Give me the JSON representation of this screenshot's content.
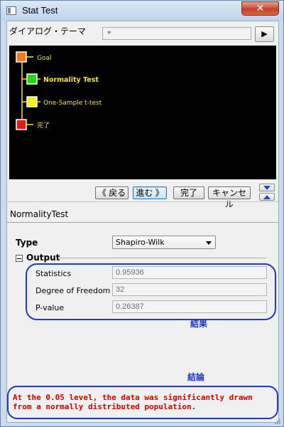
{
  "window": {
    "title": "Stat Test",
    "close_glyph": "✕"
  },
  "theme": {
    "label": "ダイアログ・テーマ",
    "value": "*",
    "play_glyph": "▶"
  },
  "tree": {
    "nodes": [
      {
        "label": "Goal",
        "color": "#f07b1c",
        "bold": false
      },
      {
        "label": "Normality Test",
        "color": "#22d90f",
        "bold": true
      },
      {
        "label": "One-Sample t-test",
        "color": "#f3ef1a",
        "bold": false
      },
      {
        "label": "完了",
        "color": "#e01a1a",
        "bold": false
      }
    ],
    "text_color": "#f0e63a",
    "line_color": "#f0e63a"
  },
  "nav": {
    "back": "《 戻る",
    "next": "進む 》",
    "finish": "完了",
    "cancel": "キャンセル"
  },
  "section": {
    "name": "NormalityTest"
  },
  "form": {
    "type_label": "Type",
    "type_value": "Shapiro-Wilk",
    "output_label": "Output",
    "rows": [
      {
        "label": "Statistics",
        "value": "0.95936"
      },
      {
        "label": "Degree of Freedom",
        "value": "32"
      },
      {
        "label": "P-value",
        "value": "0.26387"
      }
    ]
  },
  "annotations": {
    "results_label": "結果",
    "conclusion_label": "結論",
    "conclusion_text": "At the 0.05 level, the data was significantly drawn from a normally distributed population.",
    "oval_color": "#2238c6",
    "text_color": "#d40000"
  }
}
